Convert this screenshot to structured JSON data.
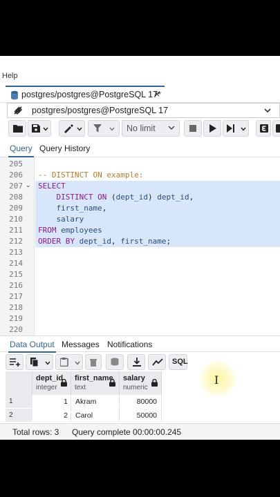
{
  "menubar": {
    "help": "Help"
  },
  "tab": {
    "title": "postgres/postgres@PostgreSQL 17*",
    "close": "×"
  },
  "connection": {
    "label": "postgres/postgres@PostgreSQL 17"
  },
  "toolbar": {
    "limit": "No limit"
  },
  "query_tabs": {
    "query": "Query",
    "history": "Query History"
  },
  "editor": {
    "lines": [
      {
        "n": "205",
        "fold": "",
        "selected": false,
        "parts": []
      },
      {
        "n": "206",
        "fold": "",
        "selected": false,
        "parts": [
          {
            "cls": "cm",
            "t": "-- DISTINCT ON example:"
          }
        ]
      },
      {
        "n": "207",
        "fold": "⌄",
        "selected": true,
        "parts": [
          {
            "cls": "kw",
            "t": "SELECT"
          }
        ]
      },
      {
        "n": "208",
        "fold": "",
        "selected": true,
        "parts": [
          {
            "cls": "",
            "t": "    "
          },
          {
            "cls": "kw",
            "t": "DISTINCT ON"
          },
          {
            "cls": "",
            "t": " ("
          },
          {
            "cls": "id",
            "t": "dept_id"
          },
          {
            "cls": "",
            "t": ") "
          },
          {
            "cls": "id",
            "t": "dept_id"
          },
          {
            "cls": "",
            "t": ","
          }
        ]
      },
      {
        "n": "209",
        "fold": "",
        "selected": true,
        "parts": [
          {
            "cls": "",
            "t": "    "
          },
          {
            "cls": "id",
            "t": "first_name"
          },
          {
            "cls": "",
            "t": ","
          }
        ]
      },
      {
        "n": "210",
        "fold": "",
        "selected": true,
        "parts": [
          {
            "cls": "",
            "t": "    "
          },
          {
            "cls": "id",
            "t": "salary"
          }
        ]
      },
      {
        "n": "211",
        "fold": "",
        "selected": true,
        "parts": [
          {
            "cls": "kw",
            "t": "FROM"
          },
          {
            "cls": "",
            "t": " "
          },
          {
            "cls": "id",
            "t": "employees"
          }
        ]
      },
      {
        "n": "212",
        "fold": "",
        "selected": true,
        "parts": [
          {
            "cls": "kw",
            "t": "ORDER BY"
          },
          {
            "cls": "",
            "t": " "
          },
          {
            "cls": "id",
            "t": "dept_id"
          },
          {
            "cls": "",
            "t": ", "
          },
          {
            "cls": "id",
            "t": "first_name"
          },
          {
            "cls": "",
            "t": ";"
          }
        ]
      },
      {
        "n": "213",
        "fold": "",
        "selected": false,
        "parts": []
      },
      {
        "n": "214",
        "fold": "",
        "selected": false,
        "parts": []
      },
      {
        "n": "215",
        "fold": "",
        "selected": false,
        "parts": []
      },
      {
        "n": "216",
        "fold": "",
        "selected": false,
        "parts": []
      },
      {
        "n": "217",
        "fold": "",
        "selected": false,
        "parts": []
      },
      {
        "n": "218",
        "fold": "",
        "selected": false,
        "parts": []
      },
      {
        "n": "219",
        "fold": "",
        "selected": false,
        "parts": []
      },
      {
        "n": "220",
        "fold": "",
        "selected": false,
        "parts": []
      }
    ]
  },
  "output_tabs": {
    "data_output": "Data Output",
    "messages": "Messages",
    "notifications": "Notifications"
  },
  "results": {
    "columns": [
      {
        "name": "dept_id",
        "type": "integer"
      },
      {
        "name": "first_name",
        "type": "text"
      },
      {
        "name": "salary",
        "type": "numeric"
      }
    ],
    "rows": [
      {
        "rn": "1",
        "cells": [
          "1",
          "Akram",
          "80000"
        ]
      },
      {
        "rn": "2",
        "cells": [
          "2",
          "Carol",
          "50000"
        ]
      }
    ],
    "sql_label": "SQL"
  },
  "status": {
    "total_rows": "Total rows: 3",
    "query_complete": "Query complete 00:00:00.245"
  },
  "colors": {
    "accent": "#326690",
    "selection": "#d7e6f8",
    "keyword": "#8a1a8a",
    "comment": "#b07a2f",
    "identifier": "#2c4d7f"
  }
}
